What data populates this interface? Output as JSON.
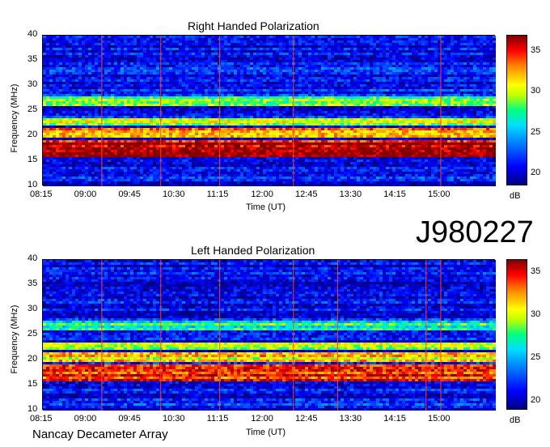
{
  "observation_id": "J980227",
  "footer": "Nancay Decameter Array",
  "chart_data": [
    {
      "type": "heatmap",
      "title": "Right Handed Polarization",
      "xlabel": "Time (UT)",
      "ylabel": "Frequency (MHz)",
      "x_ticks": [
        "08:15",
        "09:00",
        "09:45",
        "10:30",
        "11:15",
        "12:00",
        "12:45",
        "13:30",
        "14:15",
        "15:00"
      ],
      "y_ticks": [
        "10",
        "15",
        "20",
        "25",
        "30",
        "35",
        "40"
      ],
      "ylim": [
        10,
        40
      ],
      "colorbar": {
        "label": "dB",
        "ticks": [
          "20",
          "25",
          "30",
          "35"
        ],
        "range": [
          18.5,
          37
        ]
      },
      "bright_bands_mhz": [
        {
          "low": 16,
          "high": 19,
          "level_db": 36
        },
        {
          "low": 19.5,
          "high": 21.5,
          "level_db": 33
        },
        {
          "low": 22,
          "high": 23.5,
          "level_db": 30
        },
        {
          "low": 26,
          "high": 28,
          "level_db": 28
        }
      ],
      "vertical_lines_ut": [
        "09:15",
        "10:15",
        "11:15",
        "12:30",
        "15:00"
      ]
    },
    {
      "type": "heatmap",
      "title": "Left Handed Polarization",
      "xlabel": "Time (UT)",
      "ylabel": "Frequency (MHz)",
      "x_ticks": [
        "08:15",
        "09:00",
        "09:45",
        "10:30",
        "11:15",
        "12:00",
        "12:45",
        "13:30",
        "14:15",
        "15:00"
      ],
      "y_ticks": [
        "10",
        "15",
        "20",
        "25",
        "30",
        "35",
        "40"
      ],
      "ylim": [
        10,
        40
      ],
      "colorbar": {
        "label": "dB",
        "ticks": [
          "20",
          "25",
          "30",
          "35"
        ],
        "range": [
          19,
          36.5
        ]
      },
      "bright_bands_mhz": [
        {
          "low": 16,
          "high": 19,
          "level_db": 34
        },
        {
          "low": 19.5,
          "high": 21.5,
          "level_db": 31
        },
        {
          "low": 22,
          "high": 23.5,
          "level_db": 29
        },
        {
          "low": 26,
          "high": 28,
          "level_db": 27
        }
      ],
      "vertical_lines_ut": [
        "09:15",
        "10:15",
        "11:15",
        "12:30",
        "13:15",
        "14:45",
        "15:00"
      ]
    }
  ]
}
